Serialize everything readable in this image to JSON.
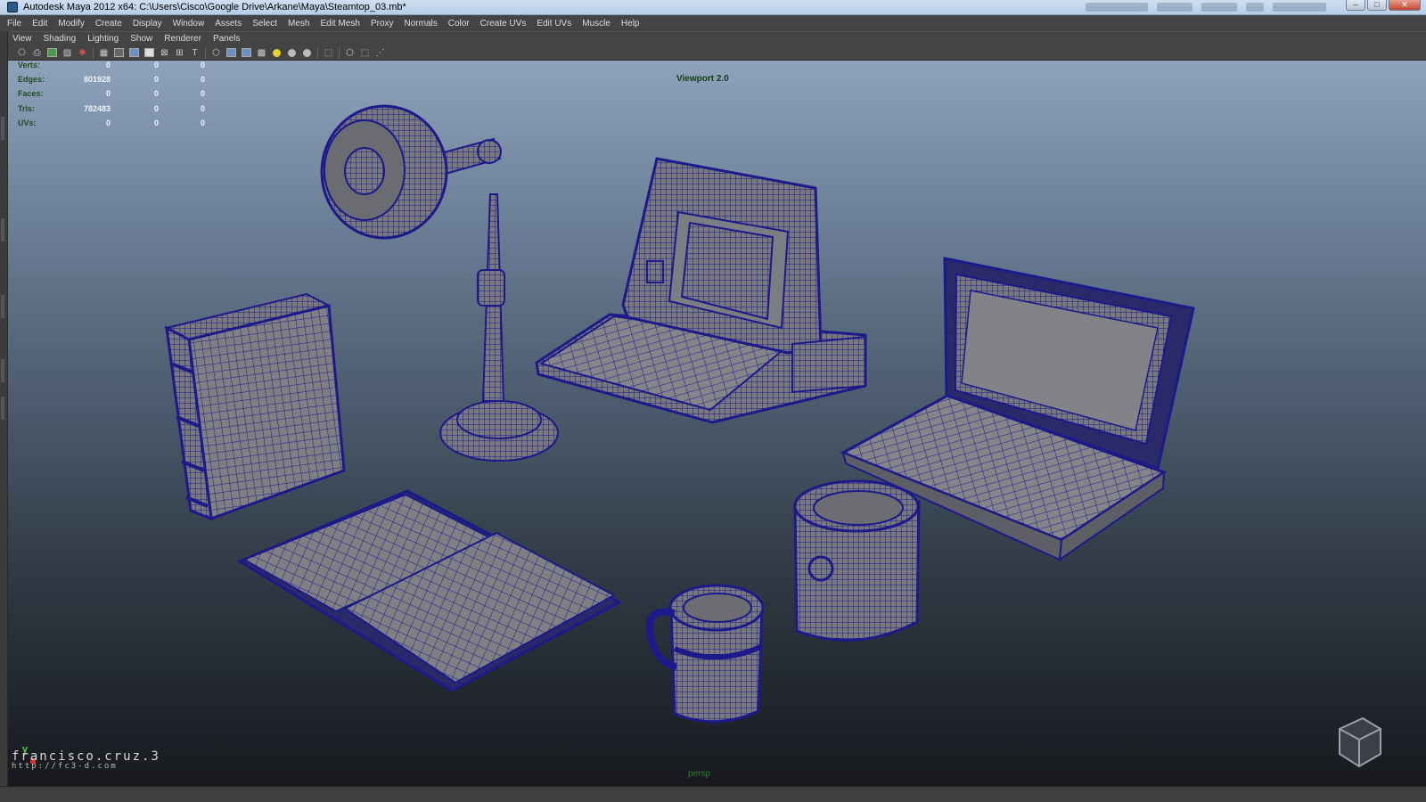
{
  "window": {
    "title": "Autodesk Maya 2012 x64: C:\\Users\\Cisco\\Google Drive\\Arkane\\Maya\\Steamtop_03.mb*",
    "controls": [
      "minimize-icon",
      "maximize-icon",
      "close-icon"
    ]
  },
  "main_menu": [
    "File",
    "Edit",
    "Modify",
    "Create",
    "Display",
    "Window",
    "Assets",
    "Select",
    "Mesh",
    "Edit Mesh",
    "Proxy",
    "Normals",
    "Color",
    "Create UVs",
    "Edit UVs",
    "Muscle",
    "Help"
  ],
  "panel_menu": [
    "View",
    "Shading",
    "Lighting",
    "Show",
    "Renderer",
    "Panels"
  ],
  "toolbar_icons": [
    "camera-icon",
    "camera-attr-icon",
    "bookmark-icon",
    "image-plane-icon",
    "2d-pan-icon",
    "grid-icon",
    "film-gate-icon",
    "resolution-gate-icon",
    "gate-mask-icon",
    "field-chart-icon",
    "safe-action-icon",
    "safe-title-icon",
    "wireframe-icon",
    "smooth-shade-icon",
    "wireframe-on-shaded-icon",
    "textured-icon",
    "use-all-lights-icon",
    "shadows-icon",
    "ambient-occlusion-icon",
    "isolate-select-icon",
    "xray-icon",
    "xray-joints-icon",
    "xray-components-icon"
  ],
  "hud": {
    "rows": [
      {
        "label": "Verts:",
        "v1": "0",
        "v2": "0",
        "v3": "0"
      },
      {
        "label": "Edges:",
        "v1": "801928",
        "v2": "0",
        "v3": "0"
      },
      {
        "label": "Faces:",
        "v1": "0",
        "v2": "0",
        "v3": "0"
      },
      {
        "label": "Tris:",
        "v1": "782483",
        "v2": "0",
        "v3": "0"
      },
      {
        "label": "UVs:",
        "v1": "0",
        "v2": "0",
        "v3": "0"
      }
    ]
  },
  "viewport": {
    "renderer_label": "Viewport 2.0",
    "camera_label": "persp",
    "axis_label": "y",
    "watermark_name": "francisco.cruz.3",
    "watermark_url": "http://fc3-d.com",
    "objects": [
      "desk-lamp",
      "retro-computer",
      "laptop",
      "closed-book",
      "open-book",
      "mug",
      "cup"
    ]
  },
  "colors": {
    "wire": "#1c1a8a",
    "mesh": "#7f7f83",
    "hud_label": "#1e4b1e",
    "hud_value": "#eef3ff"
  }
}
